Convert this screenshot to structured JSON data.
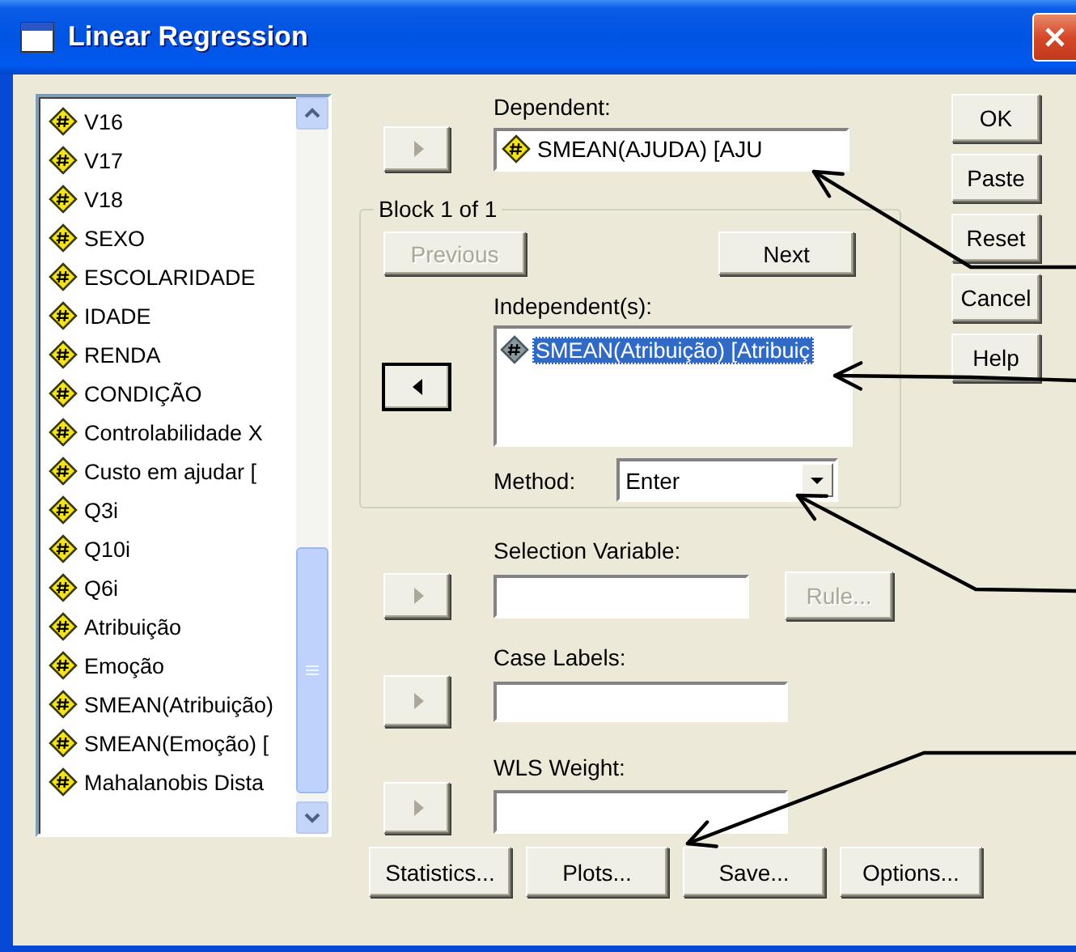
{
  "window": {
    "title": "Linear Regression"
  },
  "variables": {
    "items": [
      {
        "label": "V16"
      },
      {
        "label": "V17"
      },
      {
        "label": "V18"
      },
      {
        "label": "SEXO"
      },
      {
        "label": "ESCOLARIDADE"
      },
      {
        "label": "IDADE"
      },
      {
        "label": "RENDA"
      },
      {
        "label": "CONDIÇÃO"
      },
      {
        "label": "Controlabilidade X"
      },
      {
        "label": "Custo em ajudar ["
      },
      {
        "label": "Q3i"
      },
      {
        "label": "Q10i"
      },
      {
        "label": "Q6i"
      },
      {
        "label": "Atribuição"
      },
      {
        "label": "Emoção"
      },
      {
        "label": "SMEAN(Atribuição)"
      },
      {
        "label": "SMEAN(Emoção) ["
      },
      {
        "label": "Mahalanobis Dista"
      }
    ]
  },
  "dependent": {
    "label": "Dependent:",
    "value": "SMEAN(AJUDA) [AJU",
    "move_button": {
      "kind": "forward",
      "disabled": true,
      "focused": false
    }
  },
  "block": {
    "legend": "Block 1 of 1",
    "previous_button": {
      "label": "Previous",
      "disabled": true
    },
    "next_button": {
      "label": "Next",
      "disabled": false
    },
    "independents": {
      "label": "Independent(s):",
      "items": [
        {
          "label": "SMEAN(Atribuição) [Atribuiç",
          "selected": true
        }
      ],
      "move_button": {
        "kind": "back",
        "disabled": false,
        "focused": true
      }
    },
    "method": {
      "label": "Method:",
      "value": "Enter"
    }
  },
  "selection_variable": {
    "label": "Selection Variable:",
    "move_button": {
      "kind": "forward",
      "disabled": true,
      "focused": false
    },
    "rule_button": {
      "label": "Rule...",
      "disabled": true
    }
  },
  "case_labels": {
    "label": "Case Labels:",
    "move_button": {
      "kind": "forward",
      "disabled": true,
      "focused": false
    }
  },
  "wls_weight": {
    "label": "WLS Weight:",
    "move_button": {
      "kind": "forward",
      "disabled": true,
      "focused": false
    }
  },
  "side_buttons": [
    {
      "label": "OK",
      "disabled": false
    },
    {
      "label": "Paste",
      "disabled": false
    },
    {
      "label": "Reset",
      "disabled": false
    },
    {
      "label": "Cancel",
      "disabled": false
    },
    {
      "label": "Help",
      "disabled": false
    }
  ],
  "bottom_buttons": [
    {
      "label": "Statistics...",
      "disabled": false
    },
    {
      "label": "Plots...",
      "disabled": false
    },
    {
      "label": "Save...",
      "disabled": false
    },
    {
      "label": "Options...",
      "disabled": false
    }
  ]
}
